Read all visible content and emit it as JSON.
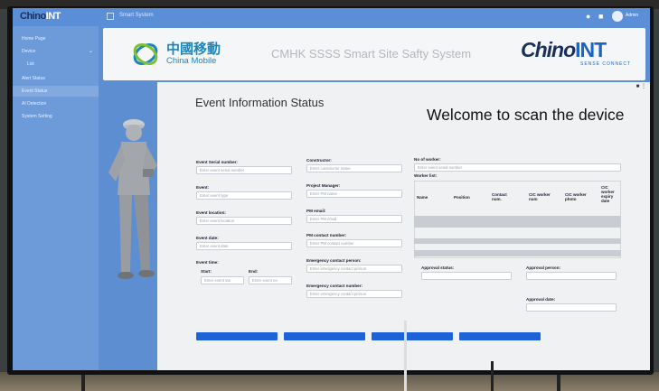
{
  "topbar": {
    "logo_main": "Chino",
    "logo_int": "INT",
    "breadcrumb": "Smart System",
    "user": "Admin"
  },
  "sidebar": {
    "items": [
      {
        "label": "Home Page",
        "active": false
      },
      {
        "label": "Device",
        "active": false
      },
      {
        "label": "List",
        "active": false
      },
      {
        "label": "Alert Status",
        "active": false
      },
      {
        "label": "Event Status",
        "active": true
      },
      {
        "label": "AI Detection",
        "active": false
      },
      {
        "label": "System Setting",
        "active": false
      }
    ]
  },
  "header": {
    "cm_cn": "中國移動",
    "cm_en": "China Mobile",
    "system_title": "CMHK SSSS Smart Site Safty System",
    "brand_main": "Chino",
    "brand_int": "INT",
    "brand_sub": "SENSE CONNECT"
  },
  "panel": {
    "title": "Event Information Status",
    "welcome": "Welcome to scan the device",
    "fields": {
      "event_serial": {
        "label": "Event Serial number:",
        "placeholder": "Enter event serial number"
      },
      "event": {
        "label": "Event:",
        "placeholder": "Enter event type"
      },
      "event_location": {
        "label": "Event location:",
        "placeholder": "Enter event location"
      },
      "event_date": {
        "label": "Event date:",
        "placeholder": "Enter event date"
      },
      "event_time": {
        "label": "Event time:"
      },
      "start": {
        "label": "Start:",
        "placeholder": "Enter event sta"
      },
      "end": {
        "label": "End:",
        "placeholder": "Enter event en"
      },
      "constructor": {
        "label": "Constructor:",
        "placeholder": "Enter constructor name"
      },
      "project_manager": {
        "label": "Project Manager:",
        "placeholder": "Enter PM name"
      },
      "pm_email": {
        "label": "PM email:",
        "placeholder": "Enter PM email"
      },
      "pm_contact": {
        "label": "PM contact number:",
        "placeholder": "Enter PM contact number"
      },
      "emergency_person": {
        "label": "Emergency contact person:",
        "placeholder": "Enter emergency contact person"
      },
      "emergency_number": {
        "label": "Emergency contact number:",
        "placeholder": "Enter emergency contact person"
      },
      "no_of_worker": {
        "label": "No of worker:",
        "placeholder": "Enter event serial number"
      },
      "worker_list": {
        "label": "Worker list:"
      },
      "approval_status": {
        "label": "Approval status:"
      },
      "approval_person": {
        "label": "Approval person:"
      },
      "approval_date": {
        "label": "Approval date:"
      }
    },
    "worker_table": {
      "headers": [
        "Name",
        "Position",
        "Contact num.",
        "CIC worker num",
        "CIC worker photo",
        "CIC worker expiry date"
      ]
    }
  }
}
